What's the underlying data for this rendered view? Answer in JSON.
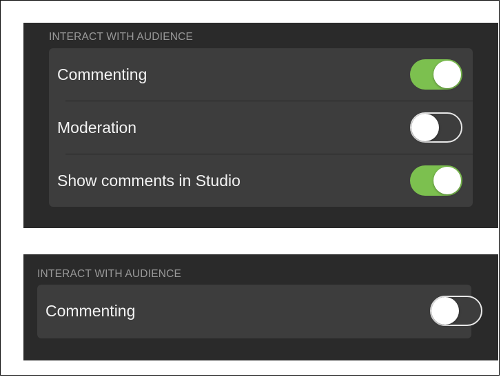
{
  "colors": {
    "panel_bg": "#2a2a2a",
    "group_bg": "#3d3d3d",
    "toggle_on": "#7cc04f",
    "header_text": "#9a9a9a",
    "label_text": "#f2f2f2"
  },
  "top_panel": {
    "header": "INTERACT WITH AUDIENCE",
    "rows": [
      {
        "label": "Commenting",
        "on": true
      },
      {
        "label": "Moderation",
        "on": false
      },
      {
        "label": "Show comments in Studio",
        "on": true
      }
    ]
  },
  "bottom_panel": {
    "header": "INTERACT WITH AUDIENCE",
    "rows": [
      {
        "label": "Commenting",
        "on": false
      }
    ]
  }
}
